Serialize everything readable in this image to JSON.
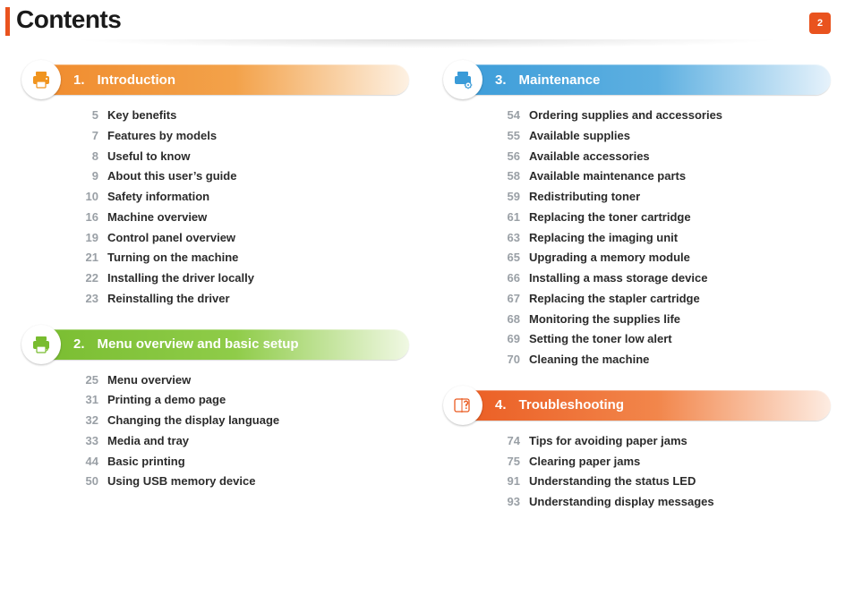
{
  "page": {
    "title": "Contents",
    "number": "2"
  },
  "columns": [
    {
      "sections": [
        {
          "num": "1.",
          "title": "Introduction",
          "icon": "printer-icon",
          "barClass": "sec-orange-a",
          "ringClass": "ring-orange-a",
          "iconColor": "#f0941f",
          "items": [
            {
              "page": "5",
              "label": "Key benefits"
            },
            {
              "page": "7",
              "label": "Features by models"
            },
            {
              "page": "8",
              "label": "Useful to know"
            },
            {
              "page": "9",
              "label": "About this user’s guide"
            },
            {
              "page": "10",
              "label": "Safety information"
            },
            {
              "page": "16",
              "label": "Machine overview"
            },
            {
              "page": "19",
              "label": "Control panel overview"
            },
            {
              "page": "21",
              "label": "Turning on the machine"
            },
            {
              "page": "22",
              "label": "Installing the driver locally"
            },
            {
              "page": "23",
              "label": "Reinstalling the driver"
            }
          ]
        },
        {
          "num": "2.",
          "title": "Menu overview and basic setup",
          "icon": "printer-setup-icon",
          "barClass": "sec-green",
          "ringClass": "ring-green",
          "iconColor": "#78bc2f",
          "items": [
            {
              "page": "25",
              "label": "Menu overview"
            },
            {
              "page": "31",
              "label": "Printing a demo page"
            },
            {
              "page": "32",
              "label": "Changing the display language"
            },
            {
              "page": "33",
              "label": "Media and tray"
            },
            {
              "page": "44",
              "label": "Basic printing"
            },
            {
              "page": "50",
              "label": "Using USB memory device"
            }
          ]
        }
      ]
    },
    {
      "sections": [
        {
          "num": "3.",
          "title": "Maintenance",
          "icon": "printer-gear-icon",
          "barClass": "sec-blue",
          "ringClass": "ring-blue",
          "iconColor": "#3a9bd8",
          "items": [
            {
              "page": "54",
              "label": "Ordering supplies and accessories"
            },
            {
              "page": "55",
              "label": "Available supplies"
            },
            {
              "page": "56",
              "label": "Available accessories"
            },
            {
              "page": "58",
              "label": "Available maintenance parts"
            },
            {
              "page": "59",
              "label": "Redistributing toner"
            },
            {
              "page": "61",
              "label": "Replacing the toner cartridge"
            },
            {
              "page": "63",
              "label": "Replacing the imaging unit"
            },
            {
              "page": "65",
              "label": "Upgrading a memory module"
            },
            {
              "page": "66",
              "label": "Installing a mass storage device"
            },
            {
              "page": "67",
              "label": "Replacing the stapler cartridge"
            },
            {
              "page": "68",
              "label": "Monitoring the supplies life"
            },
            {
              "page": "69",
              "label": "Setting the toner low alert"
            },
            {
              "page": "70",
              "label": "Cleaning the machine"
            }
          ]
        },
        {
          "num": "4.",
          "title": "Troubleshooting",
          "icon": "troubleshoot-icon",
          "barClass": "sec-orange-b",
          "ringClass": "ring-orange-b",
          "iconColor": "#ea5a20",
          "items": [
            {
              "page": "74",
              "label": "Tips for avoiding paper jams"
            },
            {
              "page": "75",
              "label": "Clearing paper jams"
            },
            {
              "page": "91",
              "label": "Understanding the status LED"
            },
            {
              "page": "93",
              "label": "Understanding display messages"
            }
          ]
        }
      ]
    }
  ]
}
